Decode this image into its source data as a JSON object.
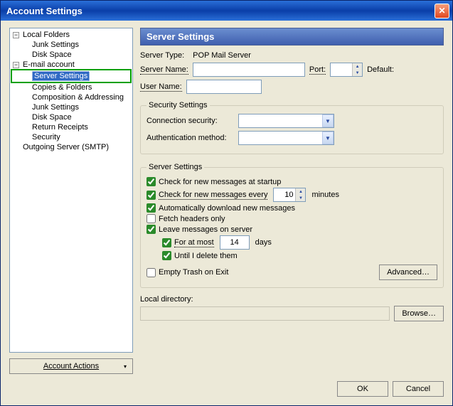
{
  "window": {
    "title": "Account Settings"
  },
  "tree": {
    "localFolders": "Local Folders",
    "localJunk": "Junk Settings",
    "localDisk": "Disk Space",
    "emailAccount": "E-mail account",
    "serverSettings": "Server Settings",
    "copiesFolders": "Copies & Folders",
    "compAddr": "Composition & Addressing",
    "junk": "Junk Settings",
    "disk": "Disk Space",
    "returnReceipts": "Return Receipts",
    "security": "Security",
    "outgoing": "Outgoing Server (SMTP)"
  },
  "accountActions": "Account Actions",
  "panel": {
    "heading": "Server Settings",
    "serverTypeLabel": "Server Type:",
    "serverTypeValue": "POP Mail Server",
    "serverNameLabel": "Server Name:",
    "serverNameValue": "",
    "portLabel": "Port:",
    "portValue": "",
    "defaultLabel": "Default:",
    "userNameLabel": "User Name:",
    "userNameValue": ""
  },
  "security": {
    "groupLabel": "Security Settings",
    "connSecLabel": "Connection security:",
    "connSecValue": "",
    "authMethodLabel": "Authentication method:",
    "authMethodValue": ""
  },
  "serverSettings": {
    "groupLabel": "Server Settings",
    "checkStartup": "Check for new messages at startup",
    "checkStartupChecked": true,
    "checkEvery": "Check for new messages every",
    "checkEveryChecked": true,
    "checkEveryValue": "10",
    "minutes": "minutes",
    "autoDownload": "Automatically download new messages",
    "autoDownloadChecked": true,
    "fetchHeaders": "Fetch headers only",
    "fetchHeadersChecked": false,
    "leaveOnServer": "Leave messages on server",
    "leaveOnServerChecked": true,
    "forAtMost": "For at most",
    "forAtMostChecked": true,
    "forAtMostValue": "14",
    "days": "days",
    "untilDelete": "Until I delete them",
    "untilDeleteChecked": true,
    "emptyTrash": "Empty Trash on Exit",
    "emptyTrashChecked": false,
    "advancedBtn": "Advanced…"
  },
  "localDir": {
    "label": "Local directory:",
    "value": "",
    "browse": "Browse…"
  },
  "footer": {
    "ok": "OK",
    "cancel": "Cancel"
  }
}
